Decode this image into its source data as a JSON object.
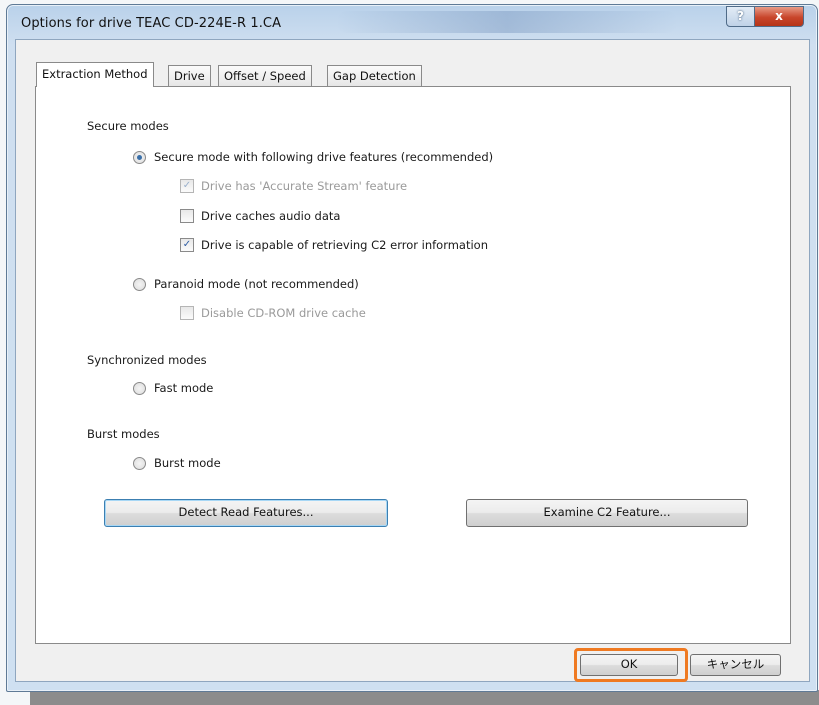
{
  "window": {
    "title": "Options for drive TEAC   CD-224E-R 1.CA",
    "help_label": "?",
    "close_label": "x"
  },
  "tabs": [
    {
      "label": "Extraction Method",
      "active": true
    },
    {
      "label": "Drive",
      "active": false
    },
    {
      "label": "Offset / Speed",
      "active": false
    },
    {
      "label": "Gap Detection",
      "active": false
    }
  ],
  "secure": {
    "group_label": "Secure modes",
    "secure_mode": {
      "label": "Secure mode with following drive features (recommended)",
      "selected": true
    },
    "accurate_stream": {
      "label": "Drive has 'Accurate Stream' feature",
      "checked": true,
      "enabled": false
    },
    "caches_audio": {
      "label": "Drive caches audio data",
      "checked": false,
      "enabled": true
    },
    "c2_info": {
      "label": "Drive is capable of retrieving C2 error information",
      "checked": true,
      "enabled": true
    },
    "paranoid_mode": {
      "label": "Paranoid mode (not recommended)",
      "selected": false
    },
    "disable_cache": {
      "label": "Disable CD-ROM drive cache",
      "checked": false,
      "enabled": false
    }
  },
  "synchronized": {
    "group_label": "Synchronized modes",
    "fast_mode": {
      "label": "Fast mode",
      "selected": false
    }
  },
  "burst": {
    "group_label": "Burst modes",
    "burst_mode": {
      "label": "Burst mode",
      "selected": false
    }
  },
  "buttons": {
    "detect": "Detect Read Features...",
    "examine": "Examine C2 Feature...",
    "ok": "OK",
    "cancel": "キャンセル"
  },
  "colors": {
    "highlight": "#ef7a22",
    "close_button": "#c8452b"
  }
}
